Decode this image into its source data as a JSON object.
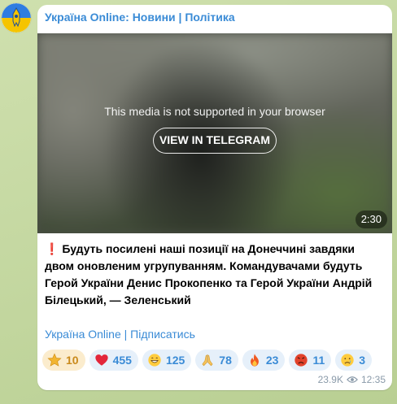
{
  "channel": {
    "name": "Україна Online: Новини | Політика"
  },
  "media": {
    "unsupported_text": "This media is not supported in your browser",
    "view_button": "VIEW IN TELEGRAM",
    "duration": "2:30"
  },
  "post": {
    "text": "Будуть посилені наші позиції на Донеччині завдяки двом оновленим угрупуванням. Командувачами будуть Герой України Денис Прокопенко та Герой України Андрій Білецький, — Зеленський",
    "signature_link": "Україна Online | Підписатись"
  },
  "reactions": [
    {
      "icon": "star-icon",
      "count": "10"
    },
    {
      "icon": "heart-icon",
      "count": "455"
    },
    {
      "icon": "grin-icon",
      "count": "125"
    },
    {
      "icon": "pray-icon",
      "count": "78"
    },
    {
      "icon": "fire-icon",
      "count": "23"
    },
    {
      "icon": "angry-face-icon",
      "count": "11"
    },
    {
      "icon": "crying-face-icon",
      "count": "3"
    }
  ],
  "meta": {
    "views": "23.9K",
    "time": "12:35"
  },
  "colors": {
    "accent": "#3a8bd6",
    "bubble": "#ffffff",
    "reaction_bg": "#e6f0fa",
    "paid_reaction_bg": "#fbeccd"
  }
}
